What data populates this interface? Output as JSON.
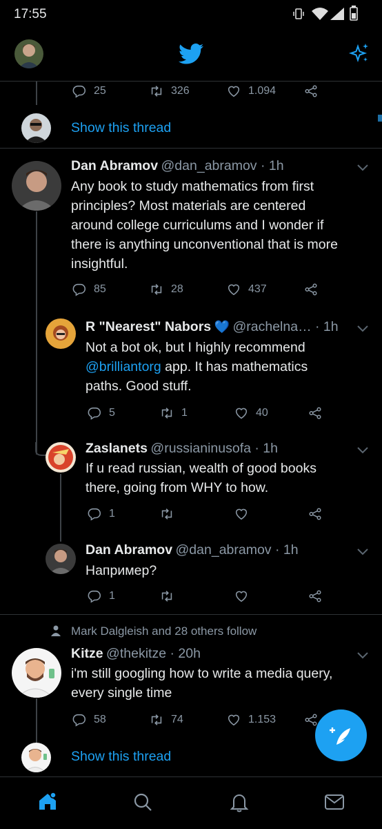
{
  "status_bar": {
    "time": "17:55"
  },
  "top_partial": {
    "replies": "25",
    "retweets": "326",
    "likes": "1.094",
    "show_thread": "Show this thread"
  },
  "tweets": [
    {
      "name": "Dan Abramov",
      "handle": "@dan_abramov · 1h",
      "lines": [
        "Any book to study mathematics from first",
        "principles? Most materials are centered",
        "around college curriculums and I wonder if",
        "there is anything unconventional that is more",
        "insightful."
      ],
      "replies": "85",
      "retweets": "28",
      "likes": "437"
    },
    {
      "name": "R \"Nearest\" Nabors",
      "heart": "💙",
      "handle": "@rachelna… · 1h",
      "line1": "Not a bot ok, but I highly recommend",
      "mention": "@brilliantorg",
      "line2_rest": " app. It has mathematics",
      "line3": "paths. Good stuff.",
      "replies": "5",
      "retweets": "1",
      "likes": "40"
    },
    {
      "name": "Zaslanets",
      "handle": "@russianinusofa · 1h",
      "lines": [
        "If u read russian, wealth of good books",
        "there, going from WHY to how."
      ],
      "replies": "1",
      "retweets": "",
      "likes": ""
    },
    {
      "name": "Dan Abramov",
      "handle": "@dan_abramov · 1h",
      "lines": [
        "Например?"
      ],
      "replies": "1",
      "retweets": "",
      "likes": ""
    },
    {
      "social_context": "Mark Dalgleish and 28 others follow",
      "name": "Kitze",
      "handle": "@thekitze · 20h",
      "lines": [
        "i'm still googling how to write a media query,",
        "every single time"
      ],
      "replies": "58",
      "retweets": "74",
      "likes": "1.153",
      "show_thread": "Show this thread"
    }
  ],
  "nav": [
    "home-icon",
    "search-icon",
    "notifications-icon",
    "messages-icon"
  ],
  "colors": {
    "accent": "#1da1f2",
    "background": "#000000",
    "secondary_text": "#8b98a5"
  }
}
